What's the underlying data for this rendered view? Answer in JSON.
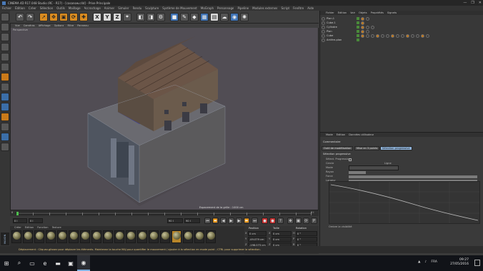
{
  "window": {
    "title": "CINEMA 4D R17.048 Studio (RC - R17) - [casanow.c4d] - Prise Principale",
    "controls": [
      "—",
      "❐",
      "✕"
    ]
  },
  "menubar": {
    "items": [
      "Fichier",
      "Édition",
      "Créer",
      "Sélection",
      "Outils",
      "Maillage",
      "Accrochage",
      "Animer",
      "Simuler",
      "Rendu",
      "Sculpture",
      "Système de Mouvement",
      "MoGraph",
      "Personnage",
      "Pipeline",
      "Modules externes",
      "Script",
      "Fenêtre",
      "Aide"
    ],
    "layout_label": "Interface :",
    "layout_value": "Standard (Utilisateur)"
  },
  "toolbar": {
    "axis_x": "X",
    "axis_y": "Y",
    "axis_z": "Z"
  },
  "viewport": {
    "menu": [
      "Vue",
      "Caméras",
      "Affichage",
      "Options",
      "Filtre",
      "Panneau"
    ],
    "label": "Perspective",
    "grid_spacing": "Espacement de la grille : 1000 cm"
  },
  "timeline": {
    "ticks": [
      "0",
      "5",
      "10",
      "15",
      "20",
      "25",
      "30",
      "35",
      "40",
      "45",
      "50",
      "55",
      "60",
      "65",
      "70",
      "75",
      "80",
      "85",
      "90"
    ],
    "end_label": "0 I"
  },
  "playback": {
    "start_field": "0 I",
    "current_field": "0 I",
    "end_field": "90 I",
    "end_field2": "90 I"
  },
  "materials": {
    "menu": [
      "Créer",
      "Édition",
      "Fonction",
      "Texture"
    ],
    "count": 18,
    "selected_index": 14
  },
  "coordinates": {
    "headers": [
      "Position",
      "Taille",
      "Rotation"
    ],
    "rows": [
      {
        "axis": "X",
        "position": "0 cm",
        "size_axis": "X",
        "size": "0 cm",
        "rot_axis": "H",
        "rotation": "0 °"
      },
      {
        "axis": "Y",
        "position": "-49.079 cm",
        "size_axis": "Y",
        "size": "0 cm",
        "rot_axis": "P",
        "rotation": "0 °"
      },
      {
        "axis": "Z",
        "position": "-198.073 cm",
        "size_axis": "Z",
        "size": "0 cm",
        "rot_axis": "B",
        "rotation": "0 °"
      }
    ],
    "mode_select": "Objet (Rel)",
    "size_select": "Taille",
    "apply_label": "Appliquer"
  },
  "objects": {
    "tabs": [
      "Fichier",
      "Édition",
      "Voir",
      "Objets",
      "Propriétés",
      "Signets"
    ],
    "items": [
      {
        "name": "Plan.1",
        "tags": 2
      },
      {
        "name": "Cube.1",
        "tags": 1
      },
      {
        "name": "Cylindre",
        "tags": 3
      },
      {
        "name": "Plan",
        "tags": 2
      },
      {
        "name": "Cube",
        "tags": 14
      },
      {
        "name": "Arrière-plan",
        "tags": 0
      }
    ]
  },
  "attributes": {
    "tabs": [
      "Mode",
      "Édition",
      "Données utilisateur"
    ],
    "object_label": "Commentaire",
    "mode_buttons": [
      "Outil de modélisation",
      "Mise en 3 points",
      "Sélection progressive"
    ],
    "section_label": "Sélection progressive",
    "fields": [
      "Sélect. Progressive",
      "Cercle",
      "Ligne",
      "Mode",
      "Rayon",
      "Force",
      "Largeur",
      "Mesure pt. Largeur"
    ],
    "help_label": "Ombre la visibilité"
  },
  "status": {
    "text": "Déplacement : Cliquez-glissez pour déplacer les éléments. Maintenez la touche MAJ pour quantifier le mouvement / ajouter à la sélection en mode point ; CTRL pour supprimer la sélection."
  },
  "taskbar": {
    "language": "FRA",
    "time": "09:27",
    "date": "27/05/2016"
  },
  "badge": "MAXON"
}
